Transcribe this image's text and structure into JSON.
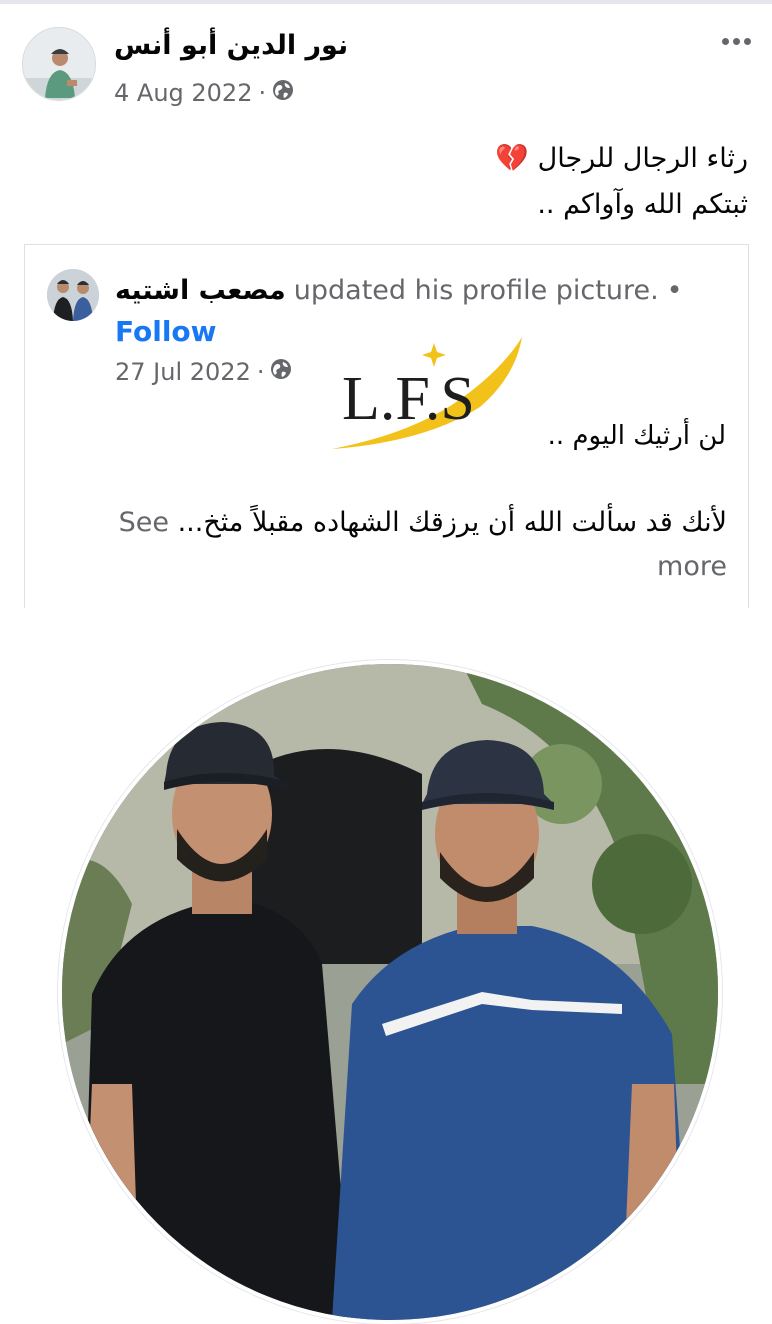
{
  "post": {
    "author": "نور الدين أبو أنس",
    "date": "4 Aug 2022",
    "separator": "·",
    "privacy_icon": "globe-icon",
    "text_line1": "رثاء الرجال للرجال",
    "emoji": "💔",
    "text_line2": "ثبتكم الله وآواكم .."
  },
  "shared": {
    "name": "مصعب اشتيه",
    "action": "updated his profile picture.",
    "bullet": "•",
    "follow_label": "Follow",
    "date": "27 Jul 2022",
    "separator": "·",
    "privacy_icon": "globe-icon",
    "logo_text": "L.F.S",
    "line1": "لن أرثيك اليوم ..",
    "body": "لأنك قد سألت الله أن يرزقك الشهاده مقبلاً مثخ...",
    "see_more": "See more"
  },
  "colors": {
    "link": "#1877f2",
    "secondary_text": "#65676b",
    "logo_yellow": "#f2c21b"
  }
}
